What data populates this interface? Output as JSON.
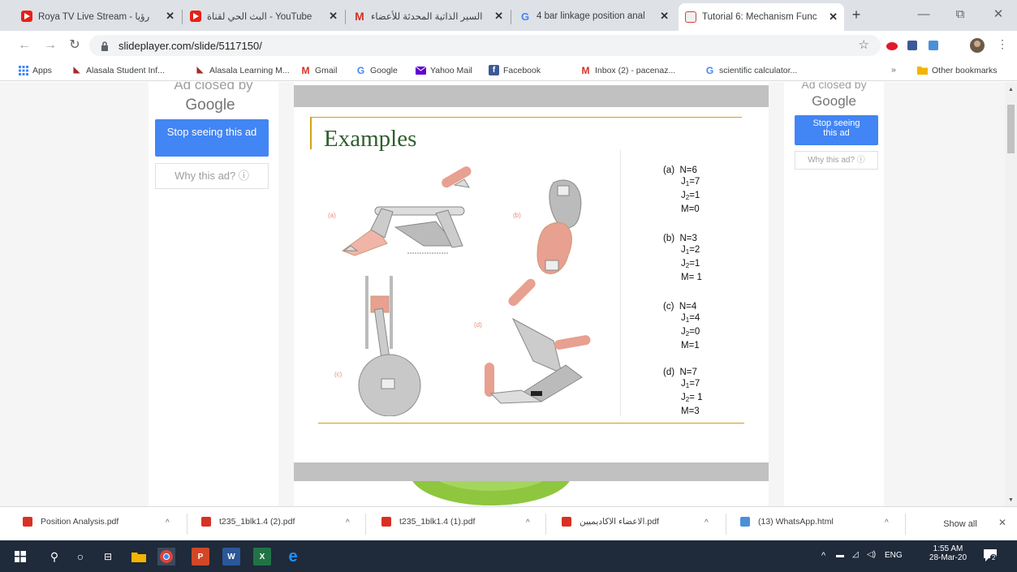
{
  "browser": {
    "tabs": [
      {
        "title": "Roya TV Live Stream - رؤيا",
        "icon": "youtube-icon"
      },
      {
        "title": "البث الحي لقناة - YouTube",
        "icon": "youtube-icon"
      },
      {
        "title": "السير الذاتية المحدثة للأعضاء",
        "icon": "gmail-icon"
      },
      {
        "title": "4 bar linkage position anal",
        "icon": "google-icon"
      },
      {
        "title": "Tutorial 6: Mechanism Func",
        "icon": "slideplayer-icon"
      }
    ],
    "new_tab": "+",
    "window_controls": {
      "minimize": "—",
      "maximize": "⧉",
      "close": "✕"
    },
    "url": "slideplayer.com/slide/5117150/",
    "bookmarks": [
      {
        "label": "Apps",
        "icon": "apps-grid-icon"
      },
      {
        "label": "Alasala Student Inf...",
        "icon": "alasala-icon"
      },
      {
        "label": "Alasala Learning M...",
        "icon": "alasala-icon"
      },
      {
        "label": "Gmail",
        "icon": "gmail-icon"
      },
      {
        "label": "Google",
        "icon": "google-icon"
      },
      {
        "label": "Yahoo Mail",
        "icon": "yahoo-mail-icon"
      },
      {
        "label": "Facebook",
        "icon": "facebook-icon"
      },
      {
        "label": "Inbox (2) - pacenaz...",
        "icon": "gmail-icon"
      },
      {
        "label": "scientific calculator...",
        "icon": "google-icon"
      }
    ],
    "bookmarks_more": "»",
    "other_bookmarks": "Other bookmarks"
  },
  "ads": {
    "left": {
      "closed_by": "Ad closed by",
      "google": "Google",
      "stop": "Stop seeing this ad",
      "why": "Why this ad? ⓘ"
    },
    "right": {
      "closed_by": "Ad closed by",
      "google": "Google",
      "stop": "Stop seeing this ad",
      "why": "Why this ad? ⓘ"
    }
  },
  "slide": {
    "title": "Examples",
    "figure_labels": {
      "a": "(a)",
      "b": "(b)",
      "c": "(c)",
      "d": "(d)"
    },
    "examples": [
      {
        "label": "(a)",
        "N": "N=6",
        "J1": "7",
        "J2": "1",
        "M": "M=0"
      },
      {
        "label": "(b)",
        "N": "N=3",
        "J1": "2",
        "J2": "1",
        "M": "M= 1"
      },
      {
        "label": "(c)",
        "N": "N=4",
        "J1": "4",
        "J2": "0",
        "M": "M=1"
      },
      {
        "label": "(d)",
        "N": "N=7",
        "J1": "7",
        "J2": " 1",
        "M": "M=3"
      }
    ]
  },
  "downloads": {
    "items": [
      {
        "name": "Position Analysis.pdf"
      },
      {
        "name": "t235_1blk1.4 (2).pdf"
      },
      {
        "name": "t235_1blk1.4 (1).pdf"
      },
      {
        "name": "الاعضاء الاكاديميين.pdf"
      },
      {
        "name": "(13) WhatsApp.html"
      }
    ],
    "show_all": "Show all",
    "close": "✕"
  },
  "taskbar": {
    "lang": "ENG",
    "time": "1:55 AM",
    "date": "28-Mar-20",
    "notification_count": "2"
  },
  "colors": {
    "tab_bg": "#dee1e6",
    "ad_button": "#4285f4",
    "slide_title": "#2e5f2e",
    "slide_rule": "#d4a017",
    "mechanism_pink": "#e8a090",
    "mechanism_grey": "#b8b8b8",
    "taskbar": "#1f2a3a"
  }
}
